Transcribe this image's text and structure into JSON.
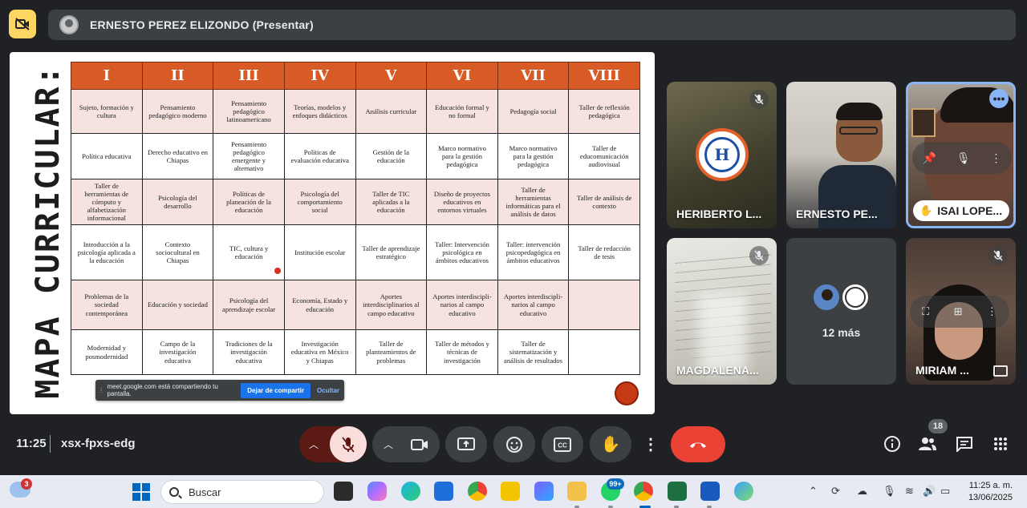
{
  "presenter": {
    "name": "ERNESTO PEREZ ELIZONDO (Presentar)"
  },
  "slide": {
    "title": "MAPA CURRICULAR:",
    "headers": [
      "I",
      "II",
      "III",
      "IV",
      "V",
      "VI",
      "VII",
      "VIII"
    ],
    "rows": [
      [
        "Sujeto, formación y cultura",
        "Pensamiento pedagógico moderno",
        "Pensamiento pedagógico latinoamericano",
        "Teorías, modelos y enfoques didácticos",
        "Análisis curricular",
        "Educación formal y no formal",
        "Pedagogía social",
        "Taller de reflexión pedagógica"
      ],
      [
        "Política educativa",
        "Derecho educativo en Chiapas",
        "Pensamiento pedagógico emergente y alternativo",
        "Políticas de evaluación educativa",
        "Gestión de la educación",
        "Marco normativo para la gestión pedagógica",
        "Marco normativo para la gestión pedagógica",
        "Taller de educomunicación audiovisual"
      ],
      [
        "Taller de herramientas de cómputo y alfabetización informacional",
        "Psicología del desarrollo",
        "Políticas de planeación de la educación",
        "Psicología del comportamiento social",
        "Taller de TIC aplicadas a la educación",
        "Diseño de proyectos educativos en entornos virtuales",
        "Taller de herramientas informáticas para el análisis de datos",
        "Taller de análisis de contexto"
      ],
      [
        "Introducción a la psicología aplicada a la educación",
        "Contexto sociocultural en Chiapas",
        "TIC, cultura y educación",
        "Institución escolar",
        "Taller de aprendizaje estratégico",
        "Taller: Intervención psicológica en ámbitos educativos",
        "Taller: intervención psicopedagógica en ámbitos educativos",
        "Taller de redacción de tesis"
      ],
      [
        "Problemas de la sociedad contemporánea",
        "Educación y sociedad",
        "Psicología del aprendizaje escolar",
        "Economía, Estado y educación",
        "Aportes interdisciplinarios al campo educativo",
        "Aportes interdiscipli-narios al campo educativo",
        "Aportes interdiscipli-narios al campo educativo",
        ""
      ],
      [
        "Modernidad y posmodernidad",
        "Campo de la investigación educativa",
        "Tradiciones de la investigación educativa",
        "Investigación educativa en México y Chiapas",
        "Taller de planteamientos de problemas",
        "Taller de métodos y técnicas de investigación",
        "Taller de sistematización y análisis de resultados",
        ""
      ]
    ]
  },
  "share_notice": {
    "text": "meet.google.com está compartiendo tu pantalla.",
    "stop_label": "Dejar de compartir",
    "hide_label": "Ocultar"
  },
  "participants": {
    "tile1_name": "HERIBERTO L...",
    "tile1_logo_text": "H",
    "tile2_name": "ERNESTO PE...",
    "tile3_name": "ISAI LOPE...",
    "tile4_name": "MAGDALENA...",
    "tile5_more": "12 más",
    "tile6_name": "MIRIAM ..."
  },
  "meeting": {
    "time": "11:25",
    "code": "xsx-fpxs-edg",
    "people_count": "18"
  },
  "taskbar": {
    "weather_badge": "3",
    "search_placeholder": "Buscar",
    "whatsapp_badge": "99+",
    "clock_time": "11:25 a. m.",
    "clock_date": "13/06/2025"
  },
  "colors": {
    "header_orange": "#d85a25",
    "row_pink": "#f6e3e0",
    "end_call_red": "#ea4335",
    "active_border": "#8ab4f8"
  }
}
